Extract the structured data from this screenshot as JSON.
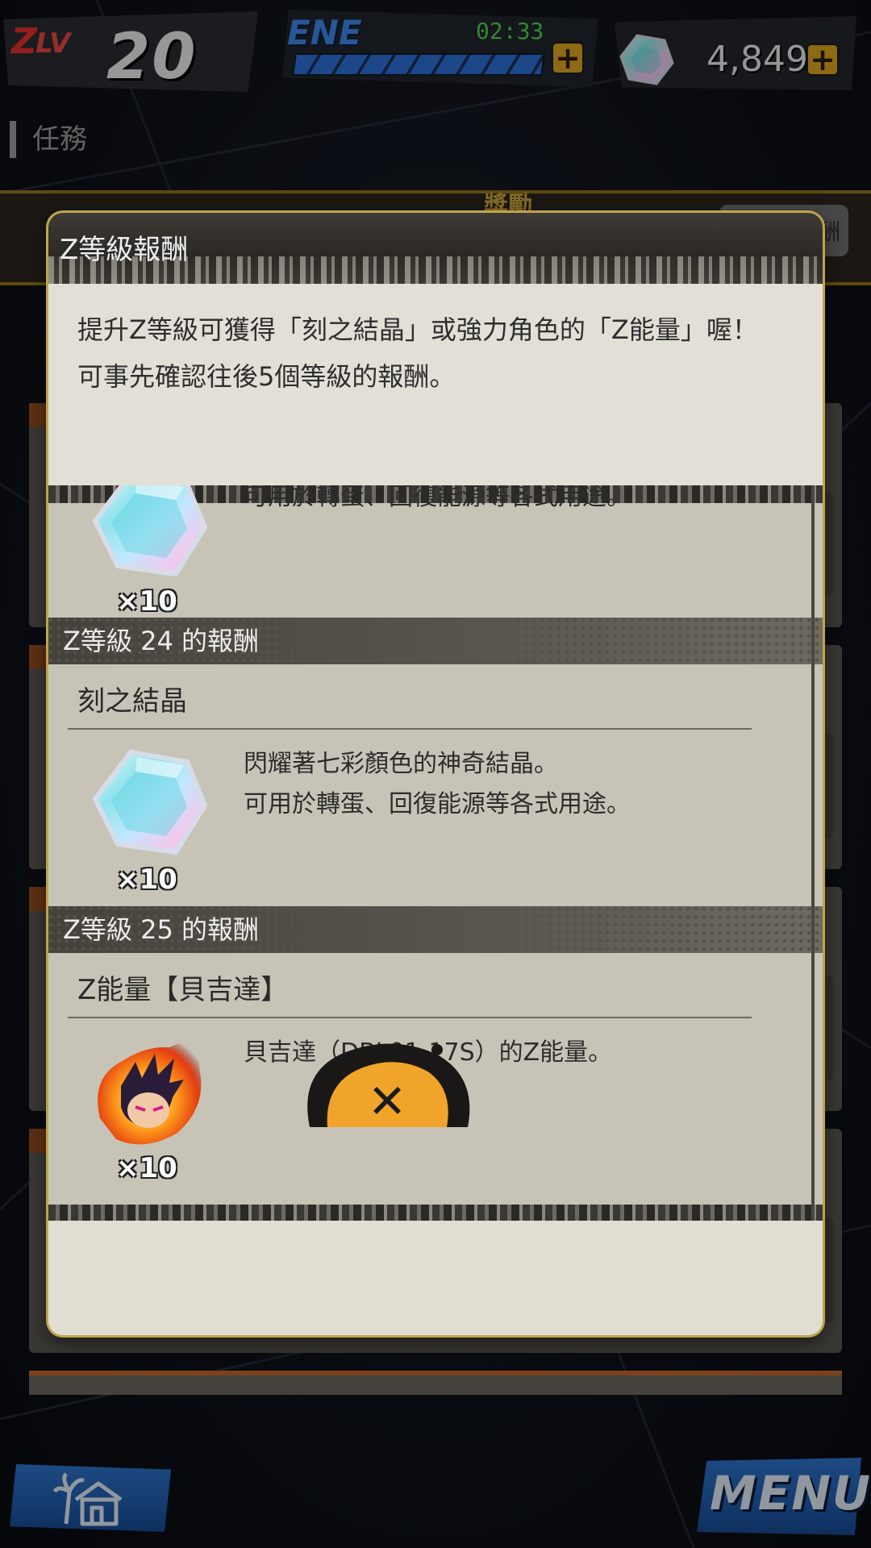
{
  "topbar": {
    "zlv_z": "Z",
    "zlv_lv": "LV",
    "zlv_value": "20",
    "ene_label": "ENE",
    "ene_timer": "02:33",
    "ene_plus": "+",
    "gem_count": "4,849",
    "gem_plus": "+"
  },
  "page": {
    "title": "任務",
    "tab_label": "獎勵",
    "side_button": "酬"
  },
  "modal": {
    "title": "Z等級報酬",
    "intro_line1": "提升Z等級可獲得「刻之結晶」或強力角色的「Z能量」喔！",
    "intro_line2": "可事先確認往後5個等級的報酬。",
    "partial_reward": {
      "desc": "可用於轉蛋、回復能源等各式用途。",
      "qty": "×10"
    },
    "rewards": [
      {
        "header": "Z等級 24 的報酬",
        "name": "刻之結晶",
        "desc": "閃耀著七彩顏色的神奇結晶。\n可用於轉蛋、回復能源等各式用途。",
        "qty": "×10",
        "icon": "crystal-icon"
      },
      {
        "header": "Z等級 25 的報酬",
        "name": "Z能量【貝吉達】",
        "desc": "貝吉達（DBL01-17S）的Z能量。",
        "qty": "×10",
        "icon": "vegeta-z-power-icon"
      }
    ],
    "close_glyph": "✕"
  },
  "bottombar": {
    "menu_label": "MENU"
  },
  "colors": {
    "accent_gold": "#d9a41e",
    "ene_blue": "#2c6fd4",
    "timer_green": "#4dd14d",
    "zlv_red": "#e53030",
    "close_orange": "#f0a52a"
  }
}
